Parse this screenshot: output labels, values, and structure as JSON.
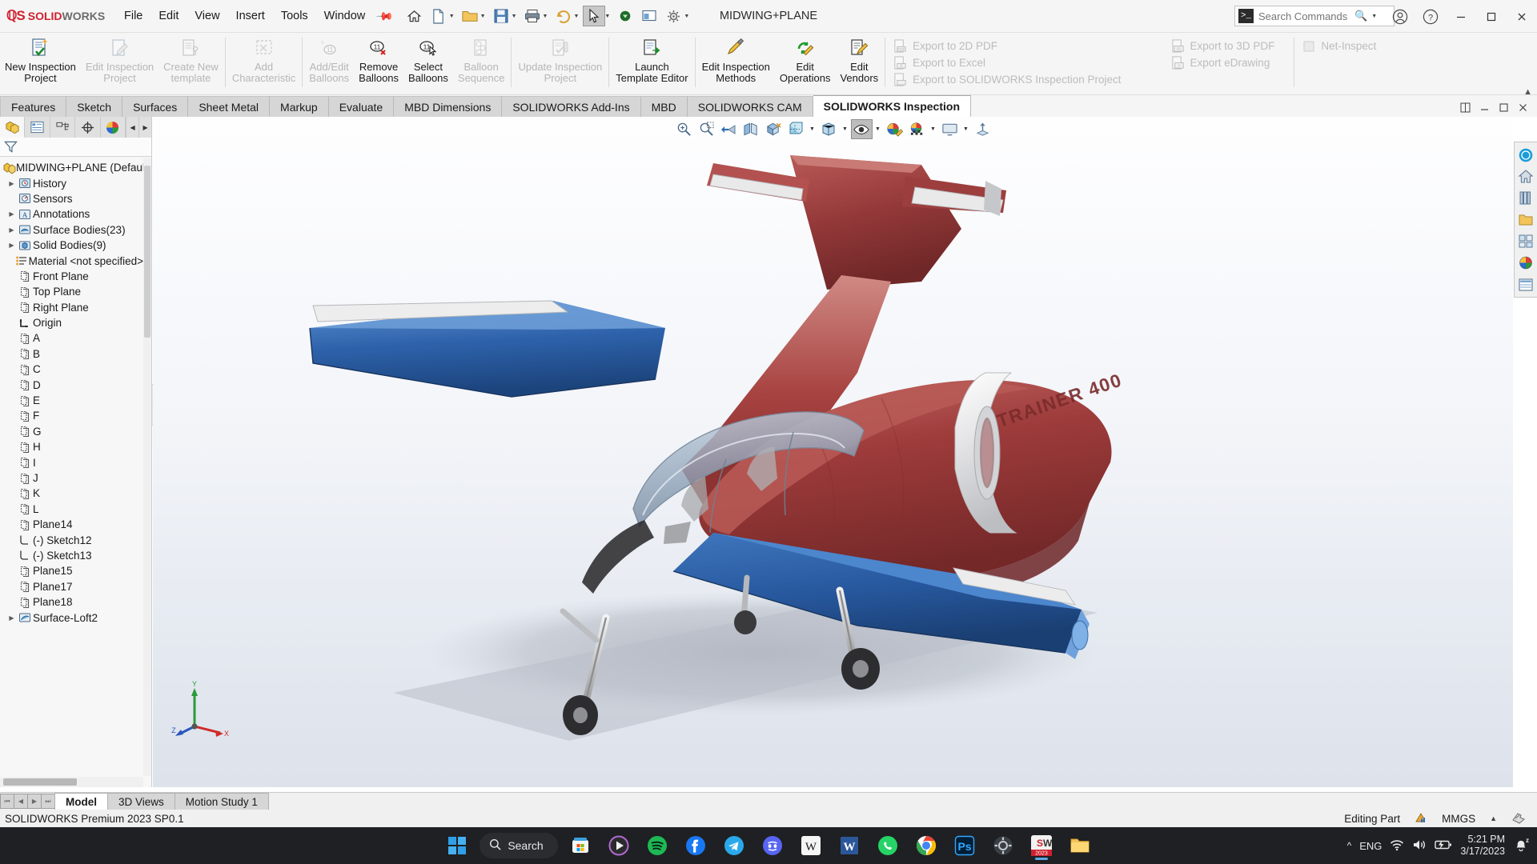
{
  "app": {
    "brand_ds": "35",
    "brand_solid": "SOLID",
    "brand_works": "WORKS",
    "document_title": "MIDWING+PLANE",
    "accent_red": "#d0202e",
    "accent_blue": "#2d6fb5"
  },
  "menubar": {
    "items": [
      {
        "label": "File"
      },
      {
        "label": "Edit"
      },
      {
        "label": "View"
      },
      {
        "label": "Insert"
      },
      {
        "label": "Tools"
      },
      {
        "label": "Window"
      }
    ],
    "pin_icon": "pin-icon"
  },
  "quick_access": {
    "buttons": [
      {
        "name": "home-icon"
      },
      {
        "name": "new-document-icon"
      },
      {
        "name": "open-document-icon"
      },
      {
        "name": "save-icon"
      },
      {
        "name": "print-icon"
      },
      {
        "name": "undo-icon"
      },
      {
        "name": "select-cursor-icon"
      },
      {
        "name": "rebuild-icon"
      },
      {
        "name": "display-settings-icon"
      },
      {
        "name": "options-gear-icon"
      }
    ]
  },
  "search": {
    "placeholder": "Search Commands",
    "value": "",
    "prompt_glyph": ">_"
  },
  "window_controls": {
    "account_icon": "user-account-icon",
    "help_icon": "help-icon",
    "minimize": "minimize-icon",
    "maximize": "maximize-icon",
    "close": "close-icon"
  },
  "ribbon": {
    "buttons": [
      {
        "label": "New Inspection\nProject",
        "icon": "new-inspection-project-icon",
        "disabled": false
      },
      {
        "label": "Edit Inspection\nProject",
        "icon": "edit-inspection-project-icon",
        "disabled": true
      },
      {
        "label": "Create New\ntemplate",
        "icon": "create-new-template-icon",
        "disabled": true
      },
      {
        "label": "Add\nCharacteristic",
        "icon": "add-characteristic-icon",
        "disabled": true
      },
      {
        "label": "Add/Edit\nBalloons",
        "icon": "add-edit-balloons-icon",
        "disabled": true
      },
      {
        "label": "Remove\nBalloons",
        "icon": "remove-balloons-icon",
        "disabled": false
      },
      {
        "label": "Select\nBalloons",
        "icon": "select-balloons-icon",
        "disabled": false
      },
      {
        "label": "Balloon\nSequence",
        "icon": "balloon-sequence-icon",
        "disabled": true
      },
      {
        "label": "Update Inspection\nProject",
        "icon": "update-inspection-project-icon",
        "disabled": true
      },
      {
        "label": "Launch\nTemplate Editor",
        "icon": "launch-template-editor-icon",
        "disabled": false
      },
      {
        "label": "Edit Inspection\nMethods",
        "icon": "edit-inspection-methods-icon",
        "disabled": false
      },
      {
        "label": "Edit\nOperations",
        "icon": "edit-operations-icon",
        "disabled": false
      },
      {
        "label": "Edit\nVendors",
        "icon": "edit-vendors-icon",
        "disabled": false
      }
    ],
    "export_column_1": [
      {
        "label": "Export to 2D PDF",
        "icon": "export-2d-pdf-icon"
      },
      {
        "label": "Export to Excel",
        "icon": "export-excel-icon"
      },
      {
        "label": "Export to SOLIDWORKS Inspection Project",
        "icon": "export-sw-inspection-icon"
      }
    ],
    "export_column_2": [
      {
        "label": "Export to 3D PDF",
        "icon": "export-3d-pdf-icon"
      },
      {
        "label": "Export eDrawing",
        "icon": "export-edrawing-icon"
      }
    ],
    "net_inspect": {
      "label": "Net-Inspect",
      "icon": "net-inspect-icon"
    },
    "collapse_icon": "chevron-up-icon"
  },
  "command_tabs": {
    "items": [
      {
        "label": "Features",
        "active": false
      },
      {
        "label": "Sketch",
        "active": false
      },
      {
        "label": "Surfaces",
        "active": false
      },
      {
        "label": "Sheet Metal",
        "active": false
      },
      {
        "label": "Markup",
        "active": false
      },
      {
        "label": "Evaluate",
        "active": false
      },
      {
        "label": "MBD Dimensions",
        "active": false
      },
      {
        "label": "SOLIDWORKS Add-Ins",
        "active": false
      },
      {
        "label": "MBD",
        "active": false
      },
      {
        "label": "SOLIDWORKS CAM",
        "active": false
      },
      {
        "label": "SOLIDWORKS Inspection",
        "active": true
      }
    ],
    "window_buttons": [
      {
        "name": "restore-panes-icon"
      },
      {
        "name": "minimize-document-icon"
      },
      {
        "name": "maximize-document-icon"
      },
      {
        "name": "close-document-icon"
      }
    ]
  },
  "feature_manager": {
    "tabs": [
      {
        "name": "feature-manager-tab",
        "icon": "feature-tree-icon",
        "active": true
      },
      {
        "name": "property-manager-tab",
        "icon": "property-manager-icon",
        "active": false
      },
      {
        "name": "configuration-manager-tab",
        "icon": "configuration-manager-icon",
        "active": false
      },
      {
        "name": "dimxpert-manager-tab",
        "icon": "dimxpert-icon",
        "active": false
      },
      {
        "name": "display-manager-tab",
        "icon": "display-manager-icon",
        "active": false
      }
    ],
    "filter_icon": "filter-funnel-icon",
    "tree": [
      {
        "label": "MIDWING+PLANE (Default)",
        "icon": "part-icon",
        "expandable": false,
        "level": 0,
        "root": true
      },
      {
        "label": "History",
        "icon": "history-icon",
        "expandable": true,
        "level": 1
      },
      {
        "label": "Sensors",
        "icon": "sensors-icon",
        "expandable": false,
        "level": 1
      },
      {
        "label": "Annotations",
        "icon": "annotations-icon",
        "expandable": true,
        "level": 1
      },
      {
        "label": "Surface Bodies(23)",
        "icon": "surface-bodies-icon",
        "expandable": true,
        "level": 1
      },
      {
        "label": "Solid Bodies(9)",
        "icon": "solid-bodies-icon",
        "expandable": true,
        "level": 1
      },
      {
        "label": "Material <not specified>",
        "icon": "material-icon",
        "expandable": false,
        "level": 1
      },
      {
        "label": "Front Plane",
        "icon": "plane-icon",
        "expandable": false,
        "level": 1
      },
      {
        "label": "Top Plane",
        "icon": "plane-icon",
        "expandable": false,
        "level": 1
      },
      {
        "label": "Right Plane",
        "icon": "plane-icon",
        "expandable": false,
        "level": 1
      },
      {
        "label": "Origin",
        "icon": "origin-icon",
        "expandable": false,
        "level": 1
      },
      {
        "label": "A",
        "icon": "plane-icon",
        "expandable": false,
        "level": 1
      },
      {
        "label": "B",
        "icon": "plane-icon",
        "expandable": false,
        "level": 1
      },
      {
        "label": "C",
        "icon": "plane-icon",
        "expandable": false,
        "level": 1
      },
      {
        "label": "D",
        "icon": "plane-icon",
        "expandable": false,
        "level": 1
      },
      {
        "label": "E",
        "icon": "plane-icon",
        "expandable": false,
        "level": 1
      },
      {
        "label": "F",
        "icon": "plane-icon",
        "expandable": false,
        "level": 1
      },
      {
        "label": "G",
        "icon": "plane-icon",
        "expandable": false,
        "level": 1
      },
      {
        "label": "H",
        "icon": "plane-icon",
        "expandable": false,
        "level": 1
      },
      {
        "label": "I",
        "icon": "plane-icon",
        "expandable": false,
        "level": 1
      },
      {
        "label": "J",
        "icon": "plane-icon",
        "expandable": false,
        "level": 1
      },
      {
        "label": "K",
        "icon": "plane-icon",
        "expandable": false,
        "level": 1
      },
      {
        "label": "L",
        "icon": "plane-icon",
        "expandable": false,
        "level": 1
      },
      {
        "label": "Plane14",
        "icon": "plane-icon",
        "expandable": false,
        "level": 1
      },
      {
        "label": "(-) Sketch12",
        "icon": "sketch-icon",
        "expandable": false,
        "level": 1
      },
      {
        "label": "(-) Sketch13",
        "icon": "sketch-icon",
        "expandable": false,
        "level": 1
      },
      {
        "label": "Plane15",
        "icon": "plane-icon",
        "expandable": false,
        "level": 1
      },
      {
        "label": "Plane17",
        "icon": "plane-icon",
        "expandable": false,
        "level": 1
      },
      {
        "label": "Plane18",
        "icon": "plane-icon",
        "expandable": false,
        "level": 1
      },
      {
        "label": "Surface-Loft2",
        "icon": "surface-loft-icon",
        "expandable": true,
        "level": 1
      }
    ]
  },
  "heads_up_toolbar": {
    "buttons": [
      {
        "name": "zoom-to-fit-icon",
        "pressed": false
      },
      {
        "name": "zoom-to-area-icon",
        "pressed": false
      },
      {
        "name": "previous-view-icon",
        "pressed": false
      },
      {
        "name": "section-view-icon",
        "pressed": false
      },
      {
        "name": "view-orientation-icon",
        "pressed": false
      },
      {
        "name": "display-style-icon",
        "pressed": false,
        "caret": true
      },
      {
        "name": "hide-show-items-icon",
        "pressed": true,
        "caret": true
      },
      {
        "name": "edit-appearance-icon",
        "pressed": false
      },
      {
        "name": "apply-scene-icon",
        "pressed": false,
        "caret": true
      },
      {
        "name": "view-settings-icon",
        "pressed": false,
        "caret": true
      },
      {
        "name": "pushpin-view-icon",
        "pressed": false
      }
    ]
  },
  "model": {
    "name": "FANTRAINER 400",
    "fuselage_color": "#a03b3b",
    "wing_color": "#2d5fa8",
    "engine_color": "#e8e8e8",
    "canopy_color": "#9fb0c4"
  },
  "axis_triad": {
    "x": "X",
    "y": "Y",
    "z": "Z"
  },
  "right_toolbar": {
    "buttons": [
      {
        "name": "3dexperience-icon"
      },
      {
        "name": "home-view-icon"
      },
      {
        "name": "design-library-icon"
      },
      {
        "name": "file-explorer-icon"
      },
      {
        "name": "view-palette-icon"
      },
      {
        "name": "appearances-scenes-icon"
      },
      {
        "name": "custom-properties-icon"
      }
    ]
  },
  "bottom_tabs": {
    "nav_buttons": [
      "first-icon",
      "previous-icon",
      "next-icon",
      "last-icon"
    ],
    "items": [
      {
        "label": "Model",
        "active": true
      },
      {
        "label": "3D Views",
        "active": false
      },
      {
        "label": "Motion Study 1",
        "active": false
      }
    ]
  },
  "status_bar": {
    "version": "SOLIDWORKS Premium 2023 SP0.1",
    "mode": "Editing Part",
    "mode_icon": "editing-part-icon",
    "units": "MMGS",
    "units_caret": "chevron-up-icon",
    "overlay_icon": "sheet-scale-icon"
  },
  "taskbar": {
    "start_icon": "windows-start-icon",
    "search_label": "Search",
    "search_icon": "search-icon",
    "apps": [
      {
        "name": "microsoft-store-icon",
        "active": false
      },
      {
        "name": "media-player-icon",
        "active": false
      },
      {
        "name": "spotify-icon",
        "active": false
      },
      {
        "name": "facebook-icon",
        "active": false
      },
      {
        "name": "telegram-icon",
        "active": false
      },
      {
        "name": "discord-icon",
        "active": false
      },
      {
        "name": "wikipedia-icon",
        "active": false
      },
      {
        "name": "word-icon",
        "active": false
      },
      {
        "name": "whatsapp-icon",
        "active": false
      },
      {
        "name": "chrome-icon",
        "active": false
      },
      {
        "name": "photoshop-icon",
        "active": false
      },
      {
        "name": "settings-app-icon",
        "active": false
      },
      {
        "name": "solidworks-2023-icon",
        "active": true
      },
      {
        "name": "file-explorer-icon",
        "active": false
      }
    ],
    "tray": {
      "overflow_icon": "chevron-up-icon",
      "language": "ENG",
      "wifi_icon": "wifi-icon",
      "volume_icon": "volume-icon",
      "battery_icon": "battery-charging-icon",
      "time": "5:21 PM",
      "date": "3/17/2023",
      "notification_icon": "notifications-silenced-icon"
    }
  }
}
